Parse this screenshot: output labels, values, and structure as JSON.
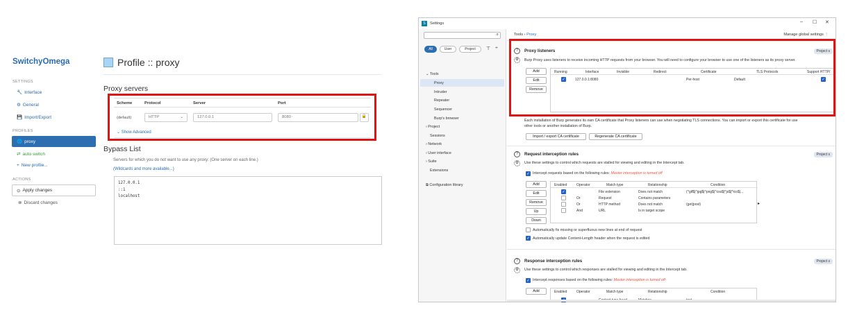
{
  "switchyomega": {
    "brand": "SwitchyOmega",
    "sections": {
      "settings": "SETTINGS",
      "profiles": "PROFILES",
      "actions": "ACTIONS"
    },
    "settings_items": [
      "Interface",
      "General",
      "Import/Export"
    ],
    "profile_items": [
      "proxy",
      "auto switch",
      "New profile..."
    ],
    "actions": {
      "apply": "Apply changes",
      "discard": "Discard changes"
    },
    "page_title": "Profile :: proxy",
    "proxy_servers": {
      "heading": "Proxy servers",
      "columns": [
        "Scheme",
        "Protocol",
        "Server",
        "Port"
      ],
      "row": {
        "scheme": "(default)",
        "protocol": "HTTP",
        "server": "127.0.0.1",
        "port": "8080"
      },
      "show_advanced": "Show Advanced"
    },
    "bypass": {
      "heading": "Bypass List",
      "description": "Servers for which you do not want to use any proxy: (One server on each line.)",
      "link": "(Wildcards and more available...)",
      "entries": [
        "127.0.0.1",
        "::1",
        "localhost"
      ]
    },
    "highlight_color": "#e11414",
    "accent_color": "#2d6eb0"
  },
  "burp": {
    "window_title": "Settings",
    "window_buttons": [
      "–",
      "☐",
      "✕"
    ],
    "filters": [
      "All",
      "User",
      "Project"
    ],
    "tree": [
      "Tools",
      "Proxy",
      "Intruder",
      "Repeater",
      "Sequencer",
      "Burp's browser",
      "Project",
      "Sessions",
      "Network",
      "User interface",
      "Suite",
      "Extensions",
      "Configuration library"
    ],
    "breadcrumb": {
      "root": "Tools",
      "sep": "›",
      "current": "Proxy"
    },
    "manage_global": "Manage global settings",
    "proxy_listeners": {
      "heading": "Proxy listeners",
      "badge": "Project s",
      "description": "Burp Proxy uses listeners to receive incoming HTTP requests from your browser. You will need to configure your browser to use one of the listeners as its proxy server.",
      "buttons": [
        "Add",
        "Edit",
        "Remove"
      ],
      "columns": [
        "Running",
        "Interface",
        "Invisible",
        "Redirect",
        "Certificate",
        "TLS Protocols",
        "Support HTTP/"
      ],
      "row": {
        "interface": "127.0.0.1:8080",
        "certificate": "Per-host",
        "tls": "Default"
      },
      "ca_text_1": "Each installation of Burp generates its own CA certificate that Proxy listeners can use when negotiating TLS connections. You can import or export this certificate for use",
      "ca_text_2": "other tools or another installation of Burp.",
      "ca_buttons": [
        "Import / export CA certificate",
        "Regenerate CA certificate"
      ]
    },
    "request_rules": {
      "heading": "Request interception rules",
      "badge": "Project s",
      "description": "Use these settings to control which requests are stalled for viewing and editing in the Intercept tab.",
      "checkbox_label": "Intercept requests based on the following rules:",
      "note": "Master interception is turned off",
      "buttons": [
        "Add",
        "Edit",
        "Remove",
        "Up",
        "Down"
      ],
      "columns": [
        "Enabled",
        "Operator",
        "Match type",
        "Relationship",
        "Condition"
      ],
      "rows": [
        {
          "operator": "",
          "match": "File extension",
          "relationship": "Does not match",
          "condition": "(^gif$|^jpg$|^png$|^css$|^js$|^ico$|..."
        },
        {
          "operator": "Or",
          "match": "Request",
          "relationship": "Contains parameters",
          "condition": ""
        },
        {
          "operator": "Or",
          "match": "HTTP method",
          "relationship": "Does not match",
          "condition": "(get|post)"
        },
        {
          "operator": "And",
          "match": "URL",
          "relationship": "Is in target scope",
          "condition": ""
        }
      ],
      "option1": "Automatically fix missing or superfluous new lines at end of request",
      "option2": "Automatically update Content-Length header when the request is edited"
    },
    "response_rules": {
      "heading": "Response interception rules",
      "badge": "Project s",
      "description": "Use these settings to control which responses are stalled for viewing and editing in the Intercept tab.",
      "checkbox_label": "Intercept responses based on the following rules:",
      "note": "Master interception is turned off",
      "buttons": [
        "Add"
      ],
      "columns": [
        "Enabled",
        "Operator",
        "Match type",
        "Relationship",
        "Condition"
      ],
      "partial_row": {
        "match": "Content type head",
        "relationship": "Matches",
        "condition": "text"
      }
    }
  }
}
